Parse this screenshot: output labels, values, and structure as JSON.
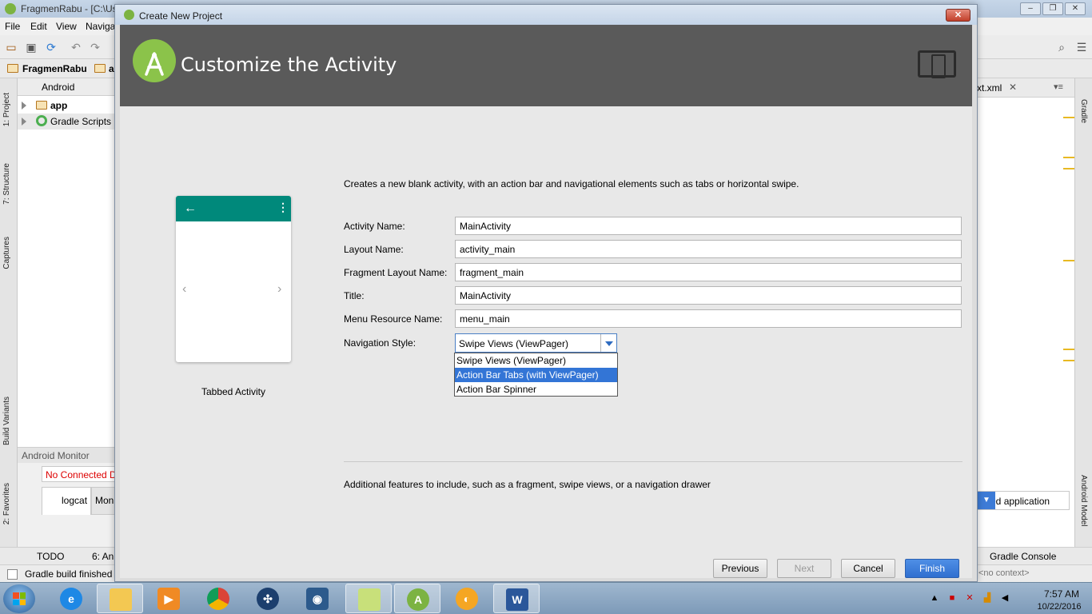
{
  "ide": {
    "window_title": "FragmenRabu - [C:\\Us",
    "menu": [
      "File",
      "Edit",
      "View",
      "Naviga"
    ],
    "breadcrumb": "FragmenRabu",
    "breadcrumb_next": "a",
    "project_view": "Android",
    "tree": [
      "app",
      "Gradle Scripts"
    ],
    "left_tabs": [
      "1: Project",
      "7: Structure",
      "Captures",
      "Build Variants",
      "2: Favorites"
    ],
    "monitor_title": "Android Monitor",
    "device": "No Connected D",
    "logcat_tab": "logcat",
    "monitor_tab": "Mon",
    "bottom_tabs": [
      "TODO",
      "6: An"
    ],
    "status": "Gradle build finished",
    "editor_tab": "xt.xml",
    "right_tabs": [
      "Gradle",
      "Android Model"
    ],
    "app_combo": "ected application",
    "gradle_console": "Gradle Console",
    "context": "<no context>"
  },
  "dialog": {
    "title": "Create New Project",
    "close_label": "✕",
    "header_title": "Customize the Activity",
    "template_name": "Tabbed Activity",
    "description": "Creates a new blank activity, with an action bar and navigational elements such as tabs or horizontal swipe.",
    "fields": {
      "activity_name": {
        "label": "Activity Name:",
        "value": "MainActivity"
      },
      "layout_name": {
        "label": "Layout Name:",
        "value": "activity_main"
      },
      "fragment_layout": {
        "label": "Fragment Layout Name:",
        "value": "fragment_main"
      },
      "title": {
        "label": "Title:",
        "value": "MainActivity"
      },
      "menu_resource": {
        "label": "Menu Resource Name:",
        "value": "menu_main"
      }
    },
    "navigation": {
      "label": "Navigation Style:",
      "selected": "Swipe Views (ViewPager)",
      "options": [
        "Swipe Views (ViewPager)",
        "Action Bar Tabs (with ViewPager)",
        "Action Bar Spinner"
      ],
      "highlighted_index": 1
    },
    "additional": "Additional features to include, such as a fragment, swipe views, or a navigation drawer",
    "buttons": {
      "previous": "Previous",
      "next": "Next",
      "cancel": "Cancel",
      "finish": "Finish"
    }
  },
  "taskbar": {
    "time": "7:57 AM",
    "date": "10/22/2016"
  },
  "colors": {
    "header_bg": "#5a5a5a",
    "phone_bar": "#00897b",
    "selection": "#3375d6",
    "android_green": "#8bc34a"
  }
}
